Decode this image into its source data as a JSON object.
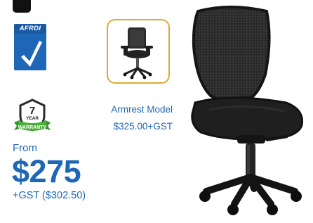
{
  "brand": {
    "certification_text": "AFRDI",
    "accent_color": "#1e67b7",
    "border_gold": "#e0a92e"
  },
  "warranty": {
    "years": "7",
    "year_label": "YEAR",
    "ribbon_text": "WARRANTY"
  },
  "variant": {
    "label": "Armrest Model",
    "price": "$325.00+GST"
  },
  "pricing": {
    "from_label": "From",
    "price": "$275",
    "gst_text": "+GST ($302.50)"
  },
  "icons": {
    "certification": "afrdi-check-icon",
    "thumbnail": "armrest-chair-thumbnail",
    "warranty": "warranty-badge-icon",
    "product": "office-chair-image"
  }
}
